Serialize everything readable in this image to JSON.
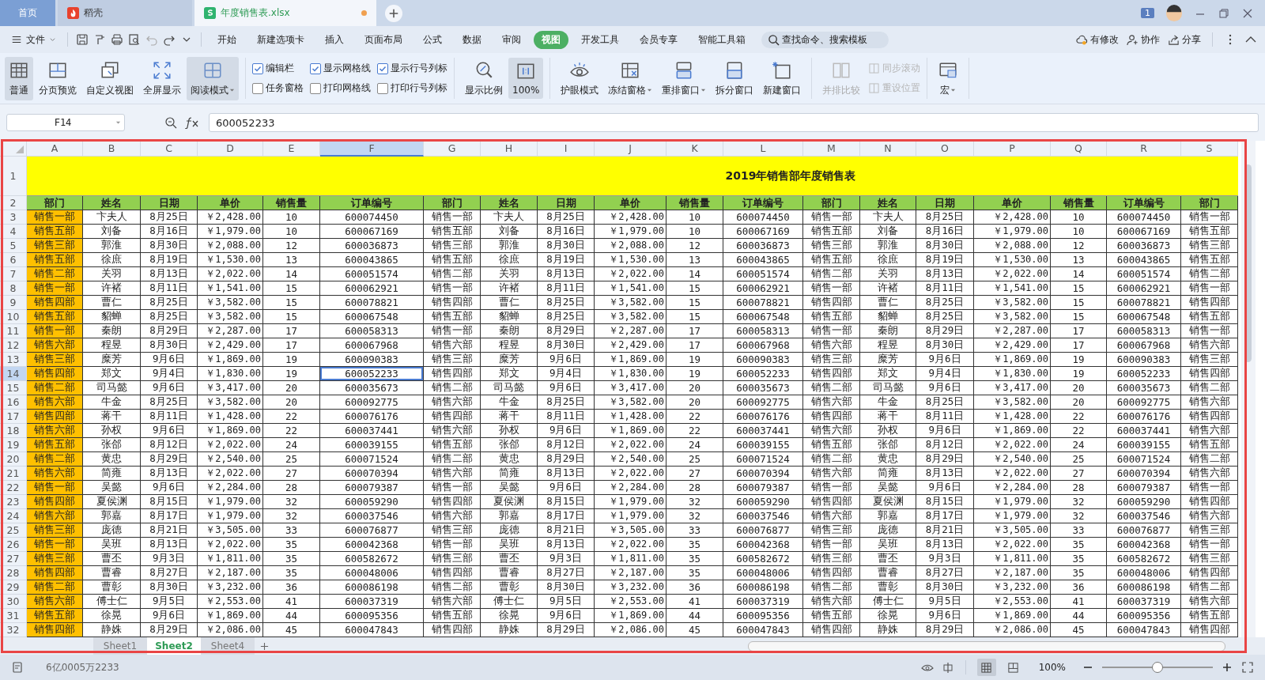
{
  "app_tabs": [
    {
      "label": "首页",
      "kind": "home",
      "selected": false,
      "unsaved": false
    },
    {
      "label": "稻壳",
      "kind": "docer",
      "selected": false,
      "unsaved": false
    },
    {
      "label": "年度销售表.xlsx",
      "kind": "sheet",
      "selected": true,
      "unsaved": true
    }
  ],
  "notification_count": "1",
  "file_menu": {
    "label": "文件"
  },
  "ribbon_tabs": [
    {
      "label": "开始",
      "selected": false
    },
    {
      "label": "新建选项卡",
      "selected": false
    },
    {
      "label": "插入",
      "selected": false
    },
    {
      "label": "页面布局",
      "selected": false
    },
    {
      "label": "公式",
      "selected": false
    },
    {
      "label": "数据",
      "selected": false
    },
    {
      "label": "审阅",
      "selected": false
    },
    {
      "label": "视图",
      "selected": true
    },
    {
      "label": "开发工具",
      "selected": false
    },
    {
      "label": "会员专享",
      "selected": false
    },
    {
      "label": "智能工具箱",
      "selected": false
    }
  ],
  "search": {
    "placeholder": "查找命令、搜索模板"
  },
  "header_actions": [
    {
      "label": "有修改",
      "kind": "cloud"
    },
    {
      "label": "协作",
      "kind": "user"
    },
    {
      "label": "分享",
      "kind": "share"
    }
  ],
  "ribbon": {
    "view_buttons": [
      {
        "label": "普通",
        "kind": "grid",
        "selected": true,
        "dropdown": false
      },
      {
        "label": "分页预览",
        "kind": "page",
        "selected": false,
        "dropdown": false
      },
      {
        "label": "自定义视图",
        "kind": "windows",
        "selected": false,
        "dropdown": false
      },
      {
        "label": "全屏显示",
        "kind": "expand",
        "selected": false,
        "dropdown": false
      },
      {
        "label": "阅读模式",
        "kind": "reading",
        "selected": true,
        "dropdown": true
      }
    ],
    "checkboxes": [
      {
        "label": "编辑栏",
        "checked": true
      },
      {
        "label": "显示网格线",
        "checked": true
      },
      {
        "label": "显示行号列标",
        "checked": true
      },
      {
        "label": "任务窗格",
        "checked": false
      },
      {
        "label": "打印网格线",
        "checked": false
      },
      {
        "label": "打印行号列标",
        "checked": false
      }
    ],
    "zoom_buttons": [
      {
        "label": "显示比例",
        "kind": "magnifier",
        "selected": false
      },
      {
        "label": "100%",
        "kind": "ratio",
        "selected": true
      }
    ],
    "window_buttons": [
      {
        "label": "护眼模式",
        "kind": "eye",
        "dropdown": false,
        "disabled": false
      },
      {
        "label": "冻结窗格",
        "kind": "freeze",
        "dropdown": true,
        "disabled": false
      },
      {
        "label": "重排窗口",
        "kind": "arrange",
        "dropdown": true,
        "disabled": false
      },
      {
        "label": "拆分窗口",
        "kind": "split",
        "dropdown": false,
        "disabled": false
      },
      {
        "label": "新建窗口",
        "kind": "new",
        "dropdown": false,
        "disabled": false
      },
      {
        "label": "并排比较",
        "kind": "compare",
        "dropdown": false,
        "disabled": true
      }
    ],
    "small_buttons": [
      {
        "label": "同步滚动",
        "disabled": true
      },
      {
        "label": "重设位置",
        "disabled": true
      }
    ],
    "macro": {
      "label": "宏",
      "dropdown": true
    }
  },
  "formula_bar": {
    "cell_ref": "F14",
    "value": "600052233"
  },
  "sheet": {
    "columns": [
      {
        "letter": "A",
        "selected": false
      },
      {
        "letter": "B",
        "selected": false
      },
      {
        "letter": "C",
        "selected": false
      },
      {
        "letter": "D",
        "selected": false
      },
      {
        "letter": "E",
        "selected": false
      },
      {
        "letter": "F",
        "selected": true
      },
      {
        "letter": "G",
        "selected": false
      },
      {
        "letter": "H",
        "selected": false
      },
      {
        "letter": "I",
        "selected": false
      },
      {
        "letter": "J",
        "selected": false
      },
      {
        "letter": "K",
        "selected": false
      },
      {
        "letter": "L",
        "selected": false
      },
      {
        "letter": "M",
        "selected": false
      },
      {
        "letter": "N",
        "selected": false
      },
      {
        "letter": "O",
        "selected": false
      },
      {
        "letter": "P",
        "selected": false
      },
      {
        "letter": "Q",
        "selected": false
      },
      {
        "letter": "R",
        "selected": false
      },
      {
        "letter": "S",
        "selected": false
      }
    ],
    "title_row": {
      "number": "1",
      "title": "2019年销售部年度销售表"
    },
    "header_row": {
      "number": "2",
      "cells": [
        "部门",
        "姓名",
        "日期",
        "单价",
        "销售量",
        "订单编号",
        "部门",
        "姓名",
        "日期",
        "单价",
        "销售量",
        "订单编号",
        "部门",
        "姓名",
        "日期",
        "单价",
        "销售量",
        "订单编号",
        "部门"
      ]
    },
    "rows": [
      {
        "number": "3",
        "selected": false,
        "cells": [
          "销售一部",
          "卞夫人",
          "8月25日",
          "￥2,428.00",
          "10",
          "600074450",
          "销售一部",
          "卞夫人",
          "8月25日",
          "￥2,428.00",
          "10",
          "600074450",
          "销售一部",
          "卞夫人",
          "8月25日",
          "￥2,428.00",
          "10",
          "600074450",
          "销售一部"
        ]
      },
      {
        "number": "4",
        "selected": false,
        "cells": [
          "销售五部",
          "刘备",
          "8月16日",
          "￥1,979.00",
          "10",
          "600067169",
          "销售五部",
          "刘备",
          "8月16日",
          "￥1,979.00",
          "10",
          "600067169",
          "销售五部",
          "刘备",
          "8月16日",
          "￥1,979.00",
          "10",
          "600067169",
          "销售五部"
        ]
      },
      {
        "number": "5",
        "selected": false,
        "cells": [
          "销售三部",
          "郭淮",
          "8月30日",
          "￥2,088.00",
          "12",
          "600036873",
          "销售三部",
          "郭淮",
          "8月30日",
          "￥2,088.00",
          "12",
          "600036873",
          "销售三部",
          "郭淮",
          "8月30日",
          "￥2,088.00",
          "12",
          "600036873",
          "销售三部"
        ]
      },
      {
        "number": "6",
        "selected": false,
        "cells": [
          "销售五部",
          "徐庶",
          "8月19日",
          "￥1,530.00",
          "13",
          "600043865",
          "销售五部",
          "徐庶",
          "8月19日",
          "￥1,530.00",
          "13",
          "600043865",
          "销售五部",
          "徐庶",
          "8月19日",
          "￥1,530.00",
          "13",
          "600043865",
          "销售五部"
        ]
      },
      {
        "number": "7",
        "selected": false,
        "cells": [
          "销售二部",
          "关羽",
          "8月13日",
          "￥2,022.00",
          "14",
          "600051574",
          "销售二部",
          "关羽",
          "8月13日",
          "￥2,022.00",
          "14",
          "600051574",
          "销售二部",
          "关羽",
          "8月13日",
          "￥2,022.00",
          "14",
          "600051574",
          "销售二部"
        ]
      },
      {
        "number": "8",
        "selected": false,
        "cells": [
          "销售一部",
          "许褚",
          "8月11日",
          "￥1,541.00",
          "15",
          "600062921",
          "销售一部",
          "许褚",
          "8月11日",
          "￥1,541.00",
          "15",
          "600062921",
          "销售一部",
          "许褚",
          "8月11日",
          "￥1,541.00",
          "15",
          "600062921",
          "销售一部"
        ]
      },
      {
        "number": "9",
        "selected": false,
        "cells": [
          "销售四部",
          "曹仁",
          "8月25日",
          "￥3,582.00",
          "15",
          "600078821",
          "销售四部",
          "曹仁",
          "8月25日",
          "￥3,582.00",
          "15",
          "600078821",
          "销售四部",
          "曹仁",
          "8月25日",
          "￥3,582.00",
          "15",
          "600078821",
          "销售四部"
        ]
      },
      {
        "number": "10",
        "selected": false,
        "cells": [
          "销售五部",
          "貂蝉",
          "8月25日",
          "￥3,582.00",
          "15",
          "600067548",
          "销售五部",
          "貂蝉",
          "8月25日",
          "￥3,582.00",
          "15",
          "600067548",
          "销售五部",
          "貂蝉",
          "8月25日",
          "￥3,582.00",
          "15",
          "600067548",
          "销售五部"
        ]
      },
      {
        "number": "11",
        "selected": false,
        "cells": [
          "销售一部",
          "秦朗",
          "8月29日",
          "￥2,287.00",
          "17",
          "600058313",
          "销售一部",
          "秦朗",
          "8月29日",
          "￥2,287.00",
          "17",
          "600058313",
          "销售一部",
          "秦朗",
          "8月29日",
          "￥2,287.00",
          "17",
          "600058313",
          "销售一部"
        ]
      },
      {
        "number": "12",
        "selected": false,
        "cells": [
          "销售六部",
          "程昱",
          "8月30日",
          "￥2,429.00",
          "17",
          "600067968",
          "销售六部",
          "程昱",
          "8月30日",
          "￥2,429.00",
          "17",
          "600067968",
          "销售六部",
          "程昱",
          "8月30日",
          "￥2,429.00",
          "17",
          "600067968",
          "销售六部"
        ]
      },
      {
        "number": "13",
        "selected": false,
        "cells": [
          "销售三部",
          "糜芳",
          "9月6日",
          "￥1,869.00",
          "19",
          "600090383",
          "销售三部",
          "糜芳",
          "9月6日",
          "￥1,869.00",
          "19",
          "600090383",
          "销售三部",
          "糜芳",
          "9月6日",
          "￥1,869.00",
          "19",
          "600090383",
          "销售三部"
        ]
      },
      {
        "number": "14",
        "selected": true,
        "cells": [
          "销售四部",
          "郑文",
          "9月4日",
          "￥1,830.00",
          "19",
          "600052233",
          "销售四部",
          "郑文",
          "9月4日",
          "￥1,830.00",
          "19",
          "600052233",
          "销售四部",
          "郑文",
          "9月4日",
          "￥1,830.00",
          "19",
          "600052233",
          "销售四部"
        ]
      },
      {
        "number": "15",
        "selected": false,
        "cells": [
          "销售二部",
          "司马懿",
          "9月6日",
          "￥3,417.00",
          "20",
          "600035673",
          "销售二部",
          "司马懿",
          "9月6日",
          "￥3,417.00",
          "20",
          "600035673",
          "销售二部",
          "司马懿",
          "9月6日",
          "￥3,417.00",
          "20",
          "600035673",
          "销售二部"
        ]
      },
      {
        "number": "16",
        "selected": false,
        "cells": [
          "销售六部",
          "牛金",
          "8月25日",
          "￥3,582.00",
          "20",
          "600092775",
          "销售六部",
          "牛金",
          "8月25日",
          "￥3,582.00",
          "20",
          "600092775",
          "销售六部",
          "牛金",
          "8月25日",
          "￥3,582.00",
          "20",
          "600092775",
          "销售六部"
        ]
      },
      {
        "number": "17",
        "selected": false,
        "cells": [
          "销售四部",
          "蒋干",
          "8月11日",
          "￥1,428.00",
          "22",
          "600076176",
          "销售四部",
          "蒋干",
          "8月11日",
          "￥1,428.00",
          "22",
          "600076176",
          "销售四部",
          "蒋干",
          "8月11日",
          "￥1,428.00",
          "22",
          "600076176",
          "销售四部"
        ]
      },
      {
        "number": "18",
        "selected": false,
        "cells": [
          "销售六部",
          "孙权",
          "9月6日",
          "￥1,869.00",
          "22",
          "600037441",
          "销售六部",
          "孙权",
          "9月6日",
          "￥1,869.00",
          "22",
          "600037441",
          "销售六部",
          "孙权",
          "9月6日",
          "￥1,869.00",
          "22",
          "600037441",
          "销售六部"
        ]
      },
      {
        "number": "19",
        "selected": false,
        "cells": [
          "销售五部",
          "张郃",
          "8月12日",
          "￥2,022.00",
          "24",
          "600039155",
          "销售五部",
          "张郃",
          "8月12日",
          "￥2,022.00",
          "24",
          "600039155",
          "销售五部",
          "张郃",
          "8月12日",
          "￥2,022.00",
          "24",
          "600039155",
          "销售五部"
        ]
      },
      {
        "number": "20",
        "selected": false,
        "cells": [
          "销售二部",
          "黄忠",
          "8月29日",
          "￥2,540.00",
          "25",
          "600071524",
          "销售二部",
          "黄忠",
          "8月29日",
          "￥2,540.00",
          "25",
          "600071524",
          "销售二部",
          "黄忠",
          "8月29日",
          "￥2,540.00",
          "25",
          "600071524",
          "销售二部"
        ]
      },
      {
        "number": "21",
        "selected": false,
        "cells": [
          "销售六部",
          "简雍",
          "8月13日",
          "￥2,022.00",
          "27",
          "600070394",
          "销售六部",
          "简雍",
          "8月13日",
          "￥2,022.00",
          "27",
          "600070394",
          "销售六部",
          "简雍",
          "8月13日",
          "￥2,022.00",
          "27",
          "600070394",
          "销售六部"
        ]
      },
      {
        "number": "22",
        "selected": false,
        "cells": [
          "销售一部",
          "吴懿",
          "9月6日",
          "￥2,284.00",
          "28",
          "600079387",
          "销售一部",
          "吴懿",
          "9月6日",
          "￥2,284.00",
          "28",
          "600079387",
          "销售一部",
          "吴懿",
          "9月6日",
          "￥2,284.00",
          "28",
          "600079387",
          "销售一部"
        ]
      },
      {
        "number": "23",
        "selected": false,
        "cells": [
          "销售四部",
          "夏侯渊",
          "8月15日",
          "￥1,979.00",
          "32",
          "600059290",
          "销售四部",
          "夏侯渊",
          "8月15日",
          "￥1,979.00",
          "32",
          "600059290",
          "销售四部",
          "夏侯渊",
          "8月15日",
          "￥1,979.00",
          "32",
          "600059290",
          "销售四部"
        ]
      },
      {
        "number": "24",
        "selected": false,
        "cells": [
          "销售六部",
          "郭嘉",
          "8月17日",
          "￥1,979.00",
          "32",
          "600037546",
          "销售六部",
          "郭嘉",
          "8月17日",
          "￥1,979.00",
          "32",
          "600037546",
          "销售六部",
          "郭嘉",
          "8月17日",
          "￥1,979.00",
          "32",
          "600037546",
          "销售六部"
        ]
      },
      {
        "number": "25",
        "selected": false,
        "cells": [
          "销售三部",
          "庞德",
          "8月21日",
          "￥3,505.00",
          "33",
          "600076877",
          "销售三部",
          "庞德",
          "8月21日",
          "￥3,505.00",
          "33",
          "600076877",
          "销售三部",
          "庞德",
          "8月21日",
          "￥3,505.00",
          "33",
          "600076877",
          "销售三部"
        ]
      },
      {
        "number": "26",
        "selected": false,
        "cells": [
          "销售一部",
          "吴班",
          "8月13日",
          "￥2,022.00",
          "35",
          "600042368",
          "销售一部",
          "吴班",
          "8月13日",
          "￥2,022.00",
          "35",
          "600042368",
          "销售一部",
          "吴班",
          "8月13日",
          "￥2,022.00",
          "35",
          "600042368",
          "销售一部"
        ]
      },
      {
        "number": "27",
        "selected": false,
        "cells": [
          "销售三部",
          "曹丕",
          "9月3日",
          "￥1,811.00",
          "35",
          "600582672",
          "销售三部",
          "曹丕",
          "9月3日",
          "￥1,811.00",
          "35",
          "600582672",
          "销售三部",
          "曹丕",
          "9月3日",
          "￥1,811.00",
          "35",
          "600582672",
          "销售三部"
        ]
      },
      {
        "number": "28",
        "selected": false,
        "cells": [
          "销售四部",
          "曹睿",
          "8月27日",
          "￥2,187.00",
          "35",
          "600048006",
          "销售四部",
          "曹睿",
          "8月27日",
          "￥2,187.00",
          "35",
          "600048006",
          "销售四部",
          "曹睿",
          "8月27日",
          "￥2,187.00",
          "35",
          "600048006",
          "销售四部"
        ]
      },
      {
        "number": "29",
        "selected": false,
        "cells": [
          "销售二部",
          "曹彰",
          "8月30日",
          "￥3,232.00",
          "36",
          "600086198",
          "销售二部",
          "曹彰",
          "8月30日",
          "￥3,232.00",
          "36",
          "600086198",
          "销售二部",
          "曹彰",
          "8月30日",
          "￥3,232.00",
          "36",
          "600086198",
          "销售二部"
        ]
      },
      {
        "number": "30",
        "selected": false,
        "cells": [
          "销售六部",
          "傅士仁",
          "9月5日",
          "￥2,553.00",
          "41",
          "600037319",
          "销售六部",
          "傅士仁",
          "9月5日",
          "￥2,553.00",
          "41",
          "600037319",
          "销售六部",
          "傅士仁",
          "9月5日",
          "￥2,553.00",
          "41",
          "600037319",
          "销售六部"
        ]
      },
      {
        "number": "31",
        "selected": false,
        "cells": [
          "销售五部",
          "徐晃",
          "9月6日",
          "￥1,869.00",
          "44",
          "600095356",
          "销售五部",
          "徐晃",
          "9月6日",
          "￥1,869.00",
          "44",
          "600095356",
          "销售五部",
          "徐晃",
          "9月6日",
          "￥1,869.00",
          "44",
          "600095356",
          "销售五部"
        ]
      },
      {
        "number": "32",
        "selected": false,
        "cells": [
          "销售四部",
          "静姝",
          "8月29日",
          "￥2,086.00",
          "45",
          "600047843",
          "销售四部",
          "静姝",
          "8月29日",
          "￥2,086.00",
          "45",
          "600047843",
          "销售四部",
          "静姝",
          "8月29日",
          "￥2,086.00",
          "45",
          "600047843",
          "销售四部"
        ]
      }
    ]
  },
  "sheet_tabs": [
    {
      "label": "Sheet1",
      "selected": false
    },
    {
      "label": "Sheet2",
      "selected": true
    },
    {
      "label": "Sheet4",
      "selected": false
    }
  ],
  "status_bar": {
    "readout": "6亿0005万2233",
    "view_modes": [
      {
        "kind": "normal",
        "selected": true
      },
      {
        "kind": "page",
        "selected": false
      }
    ],
    "zoom": "100%",
    "zoom_slider": {
      "level": 0.5
    }
  }
}
